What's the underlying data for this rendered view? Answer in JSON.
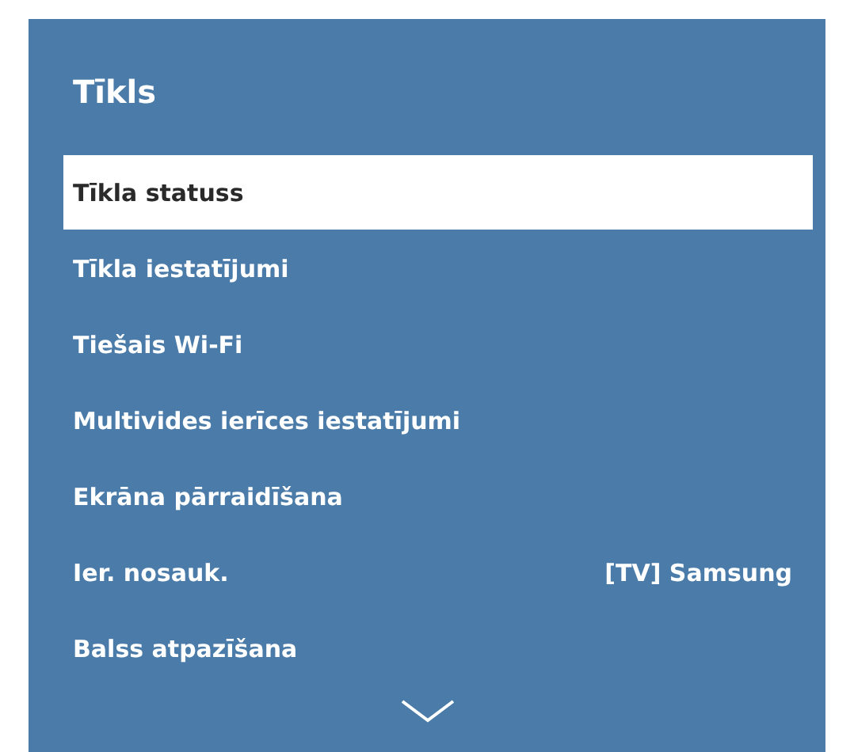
{
  "panel": {
    "title": "Tīkls"
  },
  "items": [
    {
      "label": "Tīkla statuss",
      "selected": true
    },
    {
      "label": "Tīkla iestatījumi",
      "selected": false
    },
    {
      "label": "Tiešais Wi-Fi",
      "selected": false
    },
    {
      "label": "Multivides ierīces iestatījumi",
      "selected": false
    },
    {
      "label": "Ekrāna pārraidīšana",
      "selected": false
    },
    {
      "label": "Ier. nosauk.",
      "value": "[TV] Samsung",
      "selected": false
    },
    {
      "label": "Balss atpazīšana",
      "selected": false
    }
  ],
  "more_below": true
}
